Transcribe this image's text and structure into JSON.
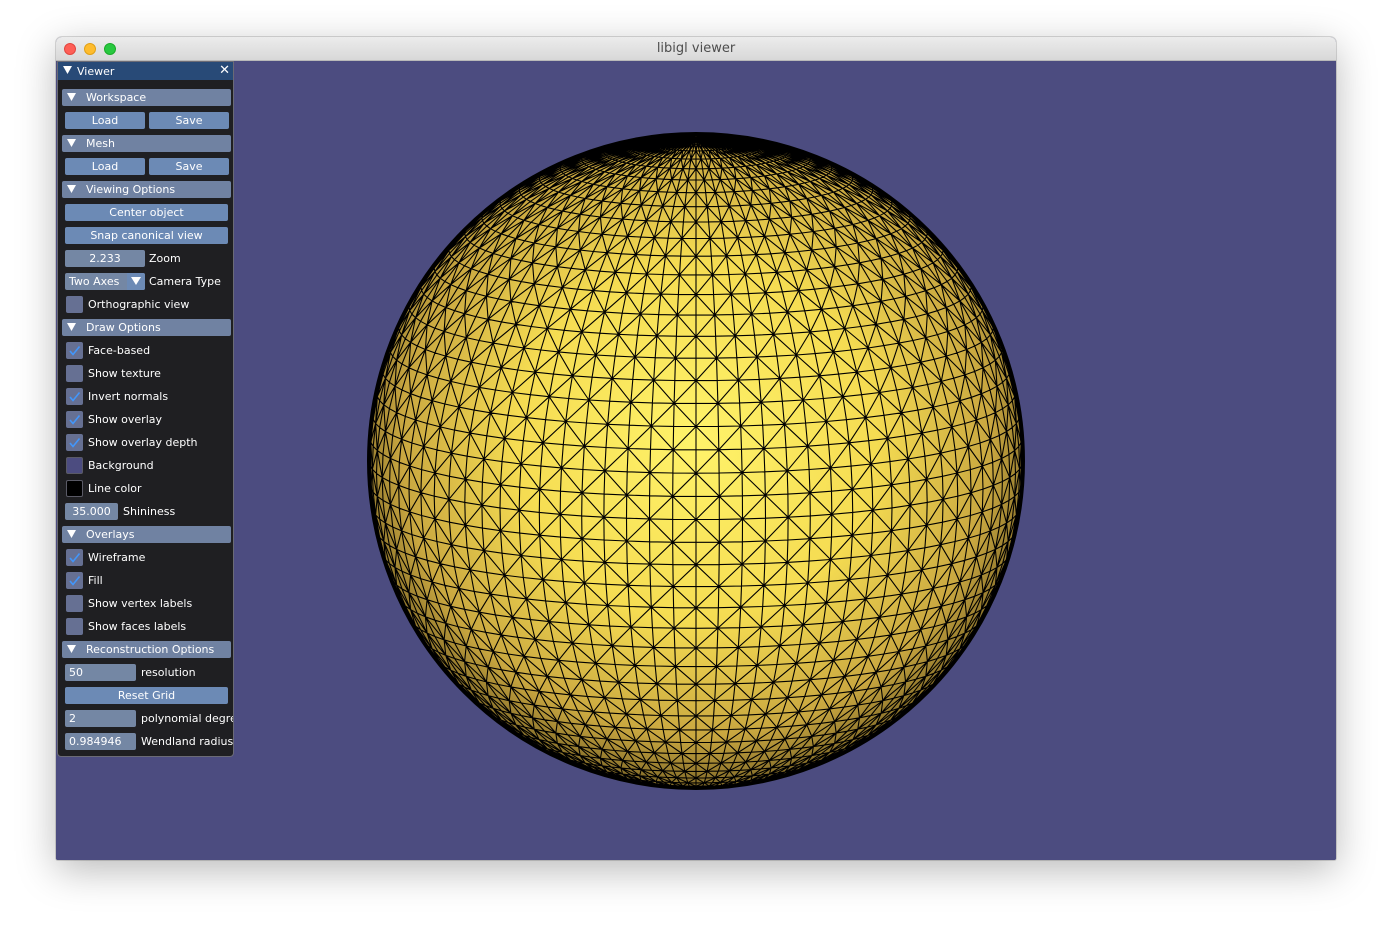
{
  "window": {
    "title": "libigl viewer"
  },
  "colors": {
    "background": "#4c4c80",
    "mesh": "#f0d94c",
    "wireframe": "#000000"
  },
  "panel": {
    "title": "Viewer",
    "workspace": {
      "header": "Workspace",
      "load": "Load",
      "save": "Save"
    },
    "mesh": {
      "header": "Mesh",
      "load": "Load",
      "save": "Save"
    },
    "viewing": {
      "header": "Viewing Options",
      "center_object": "Center object",
      "snap_view": "Snap canonical view",
      "zoom_value": "2.233",
      "zoom_label": "Zoom",
      "camera_value": "Two Axes",
      "camera_label": "Camera Type",
      "orthographic": {
        "label": "Orthographic view",
        "checked": false
      }
    },
    "draw": {
      "header": "Draw Options",
      "items": [
        {
          "label": "Face-based",
          "checked": true
        },
        {
          "label": "Show texture",
          "checked": false
        },
        {
          "label": "Invert normals",
          "checked": true
        },
        {
          "label": "Show overlay",
          "checked": true
        },
        {
          "label": "Show overlay depth",
          "checked": true
        }
      ],
      "background_label": "Background",
      "background_color": "#4c4c80",
      "line_color_label": "Line color",
      "line_color": "#000000",
      "shininess_value": "35.000",
      "shininess_label": "Shininess"
    },
    "overlays": {
      "header": "Overlays",
      "items": [
        {
          "label": "Wireframe",
          "checked": true
        },
        {
          "label": "Fill",
          "checked": true
        },
        {
          "label": "Show vertex labels",
          "checked": false
        },
        {
          "label": "Show faces labels",
          "checked": false
        }
      ]
    },
    "reconstruction": {
      "header": "Reconstruction Options",
      "resolution_value": "50",
      "resolution_label": "resolution",
      "reset_grid": "Reset Grid",
      "degree_value": "2",
      "degree_label": "polynomial degree",
      "radius_value": "0.984946",
      "radius_label": "Wendland radius"
    }
  }
}
